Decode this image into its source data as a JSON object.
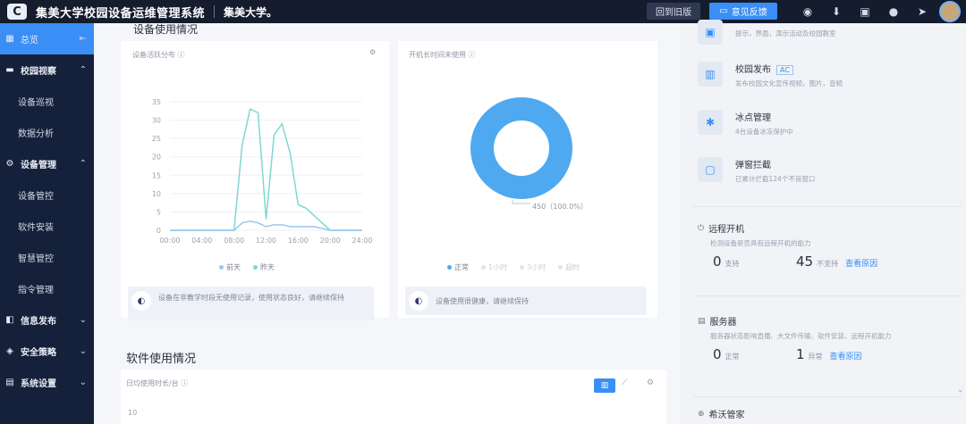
{
  "header": {
    "app_title": "集美大学校园设备运维管理系统",
    "school": "集美大学。",
    "back_old_label": "回到旧版",
    "feedback_label": "意见反馈"
  },
  "sidebar": {
    "overview": "总览",
    "patrol": {
      "label": "校园视察",
      "children": [
        "设备巡视",
        "数据分析"
      ]
    },
    "device": {
      "label": "设备管理",
      "children": [
        "设备管控",
        "软件安装",
        "智慧管控",
        "指令管理"
      ]
    },
    "info": "信息发布",
    "security": "安全策略",
    "settings": "系统设置"
  },
  "main": {
    "device_usage_title": "设备使用情况",
    "activity_label": "设备活跃分布",
    "idle_label": "开机长时间未使用",
    "line_chart": {
      "y_ticks": [
        "35",
        "30",
        "25",
        "20",
        "15",
        "10",
        "5",
        "0"
      ],
      "x_ticks": [
        "00:00",
        "04:00",
        "08:00",
        "12:00",
        "16:00",
        "20:00",
        "24:00"
      ],
      "legend": [
        "前天",
        "昨天"
      ]
    },
    "donut": {
      "label": "450（100.0%）",
      "legend": [
        "正常",
        "1小时",
        "3小时",
        "超时"
      ]
    },
    "tip1": "设备在非教学时段无使用记录，使用状态良好，请继续保持",
    "tip2": "设备使用很健康，请继续保持",
    "software_title": "软件使用情况",
    "software_sub": "日均使用时长/台",
    "software_y_top": "10"
  },
  "chart_data": [
    {
      "type": "line",
      "x": [
        "00:00",
        "02:00",
        "04:00",
        "06:00",
        "08:00",
        "09:00",
        "10:00",
        "11:00",
        "12:00",
        "13:00",
        "14:00",
        "15:00",
        "16:00",
        "17:00",
        "18:00",
        "19:00",
        "20:00",
        "21:00",
        "22:00",
        "24:00"
      ],
      "series": [
        {
          "name": "前天",
          "values": [
            0,
            0,
            0,
            0,
            0,
            23,
            33,
            32,
            3,
            26,
            29,
            21,
            7,
            6,
            4,
            2,
            0,
            0,
            0,
            0
          ]
        },
        {
          "name": "昨天",
          "values": [
            0,
            0,
            0,
            0,
            0,
            2,
            2.5,
            2,
            1,
            1.5,
            1.5,
            1,
            1,
            1,
            1,
            0.5,
            0,
            0,
            0,
            0
          ]
        }
      ],
      "ylim": [
        0,
        35
      ],
      "colors": [
        "#7fd8d0",
        "#9cc6ef"
      ]
    },
    {
      "type": "pie",
      "categories": [
        "正常",
        "1小时",
        "3小时",
        "超时"
      ],
      "values": [
        450,
        0,
        0,
        0
      ],
      "colors": [
        "#4ea9f1",
        "#e0e4ea",
        "#e0e4ea",
        "#e0e4ea"
      ]
    }
  ],
  "right": {
    "item0_desc": "提示，界面，演示活动及校园教室",
    "items": [
      {
        "title": "校园发布",
        "tag": "AC",
        "desc": "发布校园文化宣传视频，图片，音频"
      },
      {
        "title": "冰点管理",
        "desc": "4台设备冰冻保护中"
      },
      {
        "title": "弹窗拦截",
        "desc": "已累计拦截124个不良窗口"
      }
    ],
    "remote": {
      "title": "远程开机",
      "desc": "检测设备是否具有远程开机的能力",
      "supported_num": "0",
      "supported_label": "支持",
      "unsupported_num": "45",
      "unsupported_label": "不支持",
      "link": "查看原因"
    },
    "server": {
      "title": "服务器",
      "desc": "服务器状态影响直播、大文件传输、软件安装、远程开机能力",
      "normal_num": "0",
      "normal_label": "正常",
      "abnormal_num": "1",
      "abnormal_label": "异常",
      "link": "查看原因"
    },
    "bottom_title": "希沃管家"
  }
}
